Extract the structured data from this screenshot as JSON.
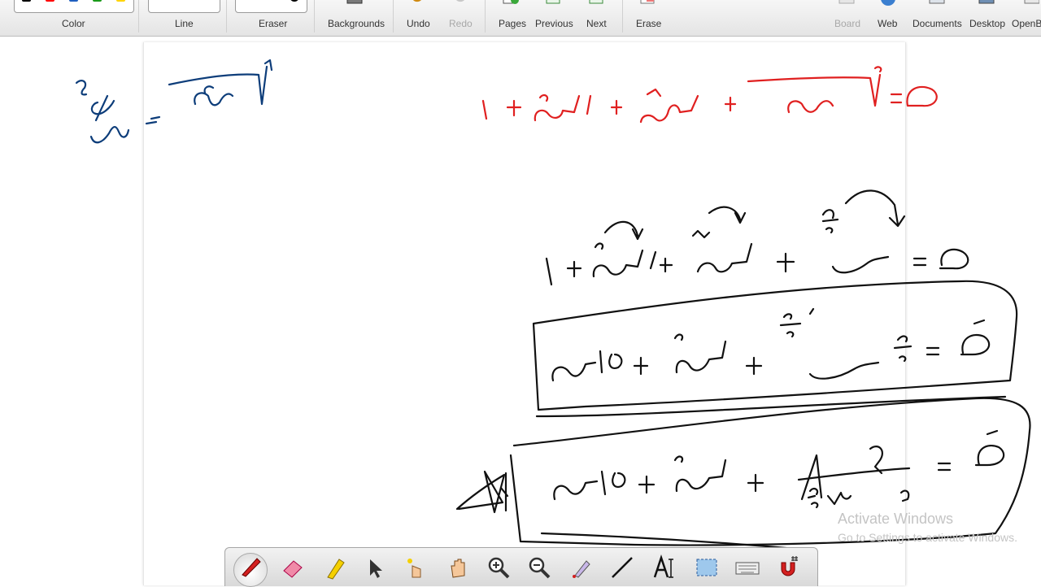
{
  "toolbar": {
    "groups": {
      "color": "Color",
      "line": "Line",
      "eraser": "Eraser"
    },
    "buttons": {
      "backgrounds": "Backgrounds",
      "undo": "Undo",
      "redo": "Redo",
      "pages": "Pages",
      "previous": "Previous",
      "next": "Next",
      "erase": "Erase",
      "board": "Board",
      "web": "Web",
      "documents": "Documents",
      "desktop": "Desktop",
      "openboard": "OpenB"
    },
    "colors": [
      "#000000",
      "#ff0000",
      "#1f5fbf",
      "#1a9a1a",
      "#ffd400"
    ]
  },
  "ink_colors": {
    "blue": "#0d3d7a",
    "red": "#e02020",
    "black": "#111111"
  },
  "watermark": {
    "title": "Activate Windows",
    "subtitle": "Go to Settings to activate Windows."
  },
  "palette": {
    "tools": [
      "pen-icon",
      "eraser-icon",
      "highlighter-icon",
      "pointer-icon",
      "laser-icon",
      "hand-icon",
      "zoom-in-icon",
      "zoom-out-icon",
      "pointer-pen-icon",
      "line-icon",
      "text-icon",
      "capture-icon",
      "keyboard-icon",
      "magnet-icon"
    ]
  }
}
